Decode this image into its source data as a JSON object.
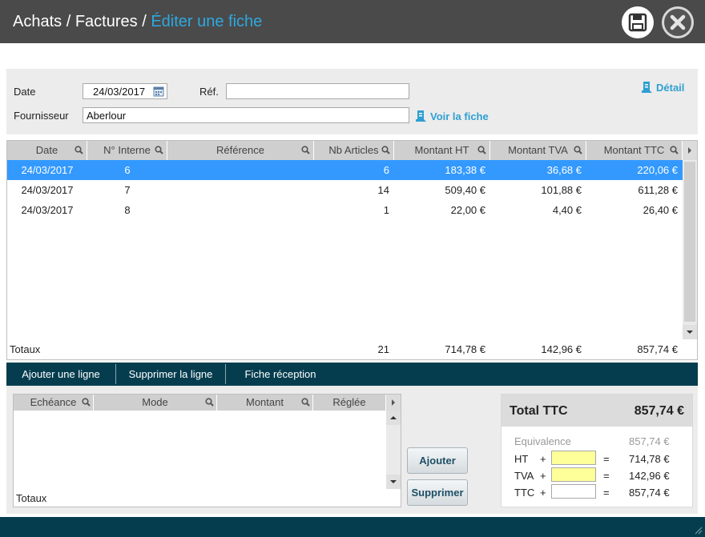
{
  "header": {
    "crumb1": "Achats",
    "sep1": " / ",
    "crumb2": "Factures",
    "sep2": " / ",
    "current": "Éditer une fiche",
    "save_icon": "floppy-disk-icon",
    "close_icon": "close-x-icon"
  },
  "form": {
    "date_label": "Date",
    "date_value": "24/03/2017",
    "ref_label": "Réf.",
    "ref_value": "",
    "supplier_label": "Fournisseur",
    "supplier_value": "Aberlour",
    "detail_link": "Détail",
    "view_link": "Voir la fiche"
  },
  "grid": {
    "columns": [
      "Date",
      "N° Interne",
      "Référence",
      "Nb Articles",
      "Montant HT",
      "Montant TVA",
      "Montant TTC"
    ],
    "rows": [
      {
        "date": "24/03/2017",
        "num": "6",
        "ref": "",
        "nb": "6",
        "ht": "183,38 €",
        "tva": "36,68 €",
        "ttc": "220,06 €",
        "selected": true
      },
      {
        "date": "24/03/2017",
        "num": "7",
        "ref": "",
        "nb": "14",
        "ht": "509,40 €",
        "tva": "101,88 €",
        "ttc": "611,28 €",
        "selected": false
      },
      {
        "date": "24/03/2017",
        "num": "8",
        "ref": "",
        "nb": "1",
        "ht": "22,00 €",
        "tva": "4,40 €",
        "ttc": "26,40 €",
        "selected": false
      }
    ],
    "totals": {
      "label": "Totaux",
      "nb": "21",
      "ht": "714,78 €",
      "tva": "142,96 €",
      "ttc": "857,74 €"
    }
  },
  "toolbar": {
    "add_line": "Ajouter une ligne",
    "delete_line": "Supprimer la ligne",
    "reception": "Fiche réception"
  },
  "schedule": {
    "columns": [
      "Echéance",
      "Mode",
      "Montant",
      "Réglée"
    ],
    "totals_label": "Totaux",
    "add_button": "Ajouter",
    "delete_button": "Supprimer"
  },
  "summary": {
    "title": "Total TTC",
    "total": "857,74 €",
    "equivalence_label": "Equivalence",
    "equivalence_value": "857,74 €",
    "ht_label": "HT",
    "ht_value": "714,78 €",
    "tva_label": "TVA",
    "tva_value": "142,96 €",
    "ttc_label": "TTC",
    "ttc_value": "857,74 €",
    "plus": "+",
    "equals": "="
  },
  "colors": {
    "accent": "#2fa8e0",
    "selected_row": "#3399ff",
    "toolbar": "#053d4f",
    "input_highlight": "#ffff99"
  }
}
